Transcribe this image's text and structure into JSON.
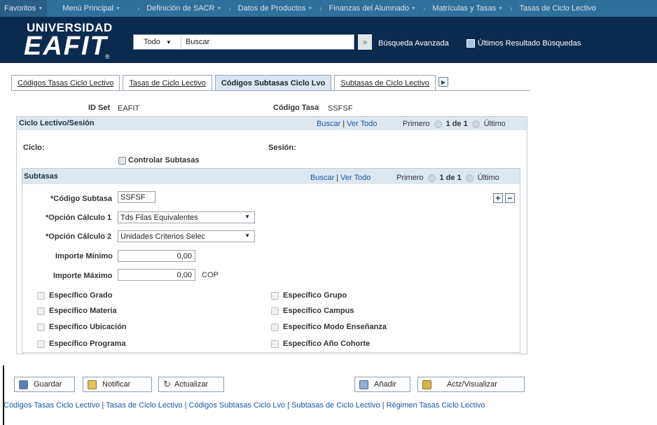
{
  "topnav": {
    "items": [
      "Favoritos",
      "Menú Principal",
      "Definición de SACR",
      "Datos de Productos",
      "Finanzas del Alumnado",
      "Matrículas y Tasas",
      "Tasas de Ciclo Lectivo"
    ]
  },
  "header": {
    "logo_top": "UNIVERSIDAD",
    "logo_main": "EAFIT",
    "logo_reg": "®",
    "search_scope": "Todo",
    "search_placeholder": "Buscar",
    "advanced_search": "Búsqueda Avanzada",
    "last_results": "Últimos Resultado Búsquedas"
  },
  "tabs": [
    "Códigos Tasas Ciclo Lectivo",
    "Tasas de Ciclo Lectivo",
    "Códigos Subtasas Ciclo Lvo",
    "Subtasas de Ciclo Lectivo"
  ],
  "key": {
    "id_set_label": "ID Set",
    "id_set_value": "EAFIT",
    "codigo_tasa_label": "Código Tasa",
    "codigo_tasa_value": "SSFSF"
  },
  "ciclo": {
    "title": "Ciclo Lectivo/Sesión",
    "buscar": "Buscar",
    "ver_todo": "Ver Todo",
    "primero": "Primero",
    "count": "1 de 1",
    "ultimo": "Último",
    "ciclo_label": "Ciclo:",
    "sesion_label": "Sesión:",
    "controlar": "Controlar Subtasas"
  },
  "subtasas": {
    "title": "Subtasas",
    "buscar": "Buscar",
    "ver_todo": "Ver Todo",
    "primero": "Primero",
    "count": "1 de 1",
    "ultimo": "Último",
    "codigo_label": "*Código Subtasa",
    "codigo_value": "SSFSF",
    "opcion1_label": "*Opción Cálculo 1",
    "opcion1_value": "Tds Filas Equivalentes",
    "opcion2_label": "*Opción Cálculo 2",
    "opcion2_value": "Unidades Criterios Selec",
    "min_label": "Importe Mínimo",
    "min_value": "0,00",
    "max_label": "Importe Máximo",
    "max_value": "0,00",
    "currency": "COP",
    "checks_left": [
      "Específico Grado",
      "Específico Materia",
      "Específico Ubicación",
      "Específico Programa"
    ],
    "checks_right": [
      "Específico Grupo",
      "Específico Campus",
      "Específico Modo Enseñanza",
      "Específico Año Cohorte"
    ]
  },
  "buttons": {
    "guardar": "Guardar",
    "notificar": "Notificar",
    "actualizar": "Actualizar",
    "anadir": "Añadir",
    "actz": "Actz/Visualizar"
  },
  "bottom_links": "Códigos Tasas Ciclo Lectivo | Tasas de Ciclo Lectivo | Códigos Subtasas Ciclo Lvo | Subtasas de Ciclo Lectivo | Régimen Tasas Ciclo Lectivo"
}
